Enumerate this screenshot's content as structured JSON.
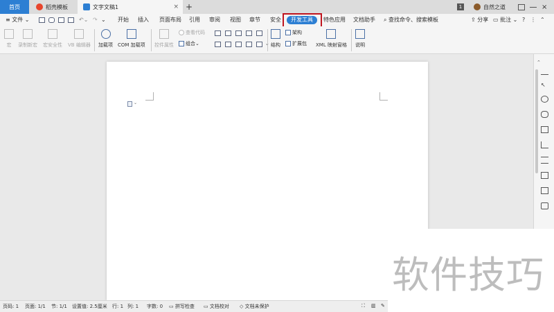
{
  "tabs": {
    "home": "首页",
    "template": "稻壳模板",
    "document": "文字文稿1",
    "add": "+"
  },
  "titlebar_right": {
    "badge": "1",
    "user": "自然之道"
  },
  "menu": {
    "file": "文件",
    "items": [
      "开始",
      "插入",
      "页面布局",
      "引用",
      "审阅",
      "视图",
      "章节",
      "安全",
      "开发工具",
      "特色应用",
      "文档助手"
    ],
    "search": "查找命令、搜索模板",
    "share": "分享",
    "comment": "批注",
    "help": "?"
  },
  "toolbar": {
    "macro": "宏",
    "record_macro": "录制新宏",
    "macro_security": "宏安全性",
    "vb_editor": "VB 编辑器",
    "addins": "加载项",
    "com_addins": "COM 加载项",
    "control_props": "控件属性",
    "view_code": "查看代码",
    "group": "组合",
    "structure": "结构",
    "schema": "架构",
    "expansion_pack": "扩展包",
    "xml_pane": "XML 映射窗格",
    "help": "说明"
  },
  "statusbar": {
    "page": "页码: 1",
    "pages": "页面: 1/1",
    "section": "节: 1/1",
    "setting": "设置值: 2.5厘米",
    "row": "行: 1",
    "col": "列: 1",
    "words": "字数: 0",
    "spell": "拼写检查",
    "proof": "文档校对",
    "protect": "文档未保护"
  },
  "watermark": "软件技巧",
  "colors": {
    "accent": "#2d7fd3",
    "highlight_box": "#c0141e"
  }
}
